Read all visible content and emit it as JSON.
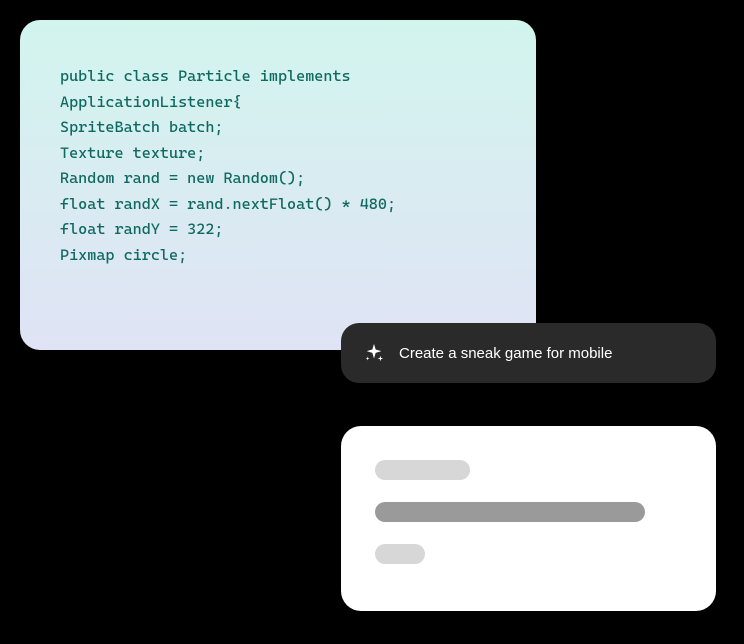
{
  "code": {
    "content": "public class Particle implements ApplicationListener{\nSpriteBatch batch;\nTexture texture;\nRandom rand = new Random();\nfloat randX = rand.nextFloat() * 480;\nfloat randY = 322;\nPixmap circle;"
  },
  "prompt": {
    "icon": "sparkle-icon",
    "text": "Create a sneak game for mobile"
  }
}
